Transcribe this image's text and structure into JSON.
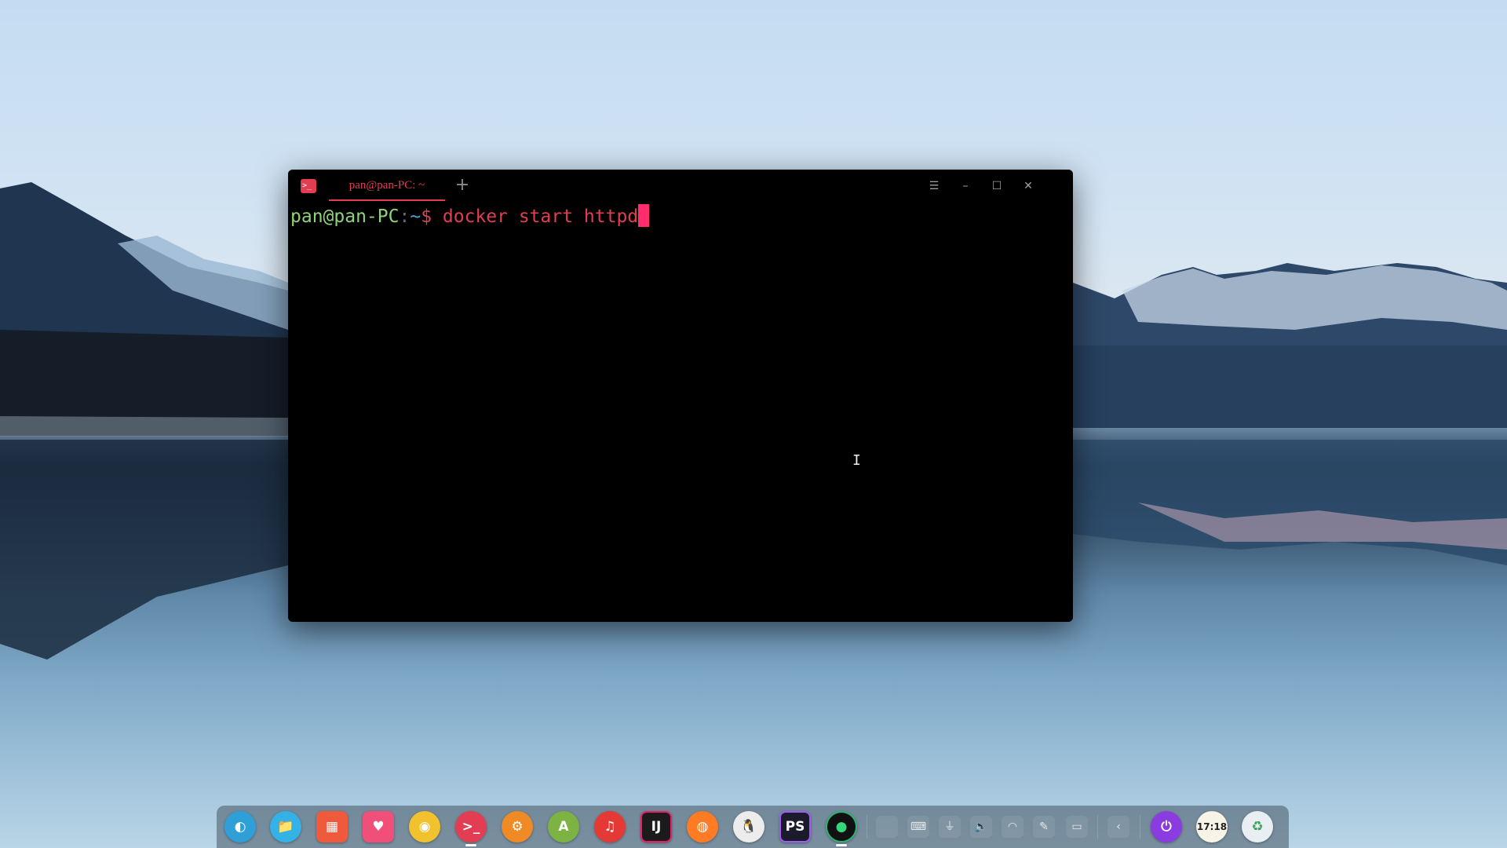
{
  "terminal": {
    "tab_title": "pan@pan-PC: ~",
    "new_tab_label": "+",
    "menu_glyph": "☰",
    "minimize_glyph": "–",
    "maximize_glyph": "☐",
    "close_glyph": "✕",
    "prompt_user": "pan@pan-PC",
    "prompt_colon": ":",
    "prompt_path": "~",
    "prompt_symbol": "$",
    "command": " docker start httpd",
    "accent_color": "#e23d53"
  },
  "dock": {
    "apps": [
      {
        "name": "deepin-launcher-icon",
        "glyph": "◐"
      },
      {
        "name": "file-manager-icon",
        "glyph": "📁"
      },
      {
        "name": "multitasking-view-icon",
        "glyph": "▦"
      },
      {
        "name": "app-store-icon",
        "glyph": "♥"
      },
      {
        "name": "chrome-icon",
        "glyph": "◉"
      },
      {
        "name": "terminal-icon",
        "glyph": ">_"
      },
      {
        "name": "system-settings-icon",
        "glyph": "⚙"
      },
      {
        "name": "android-studio-icon",
        "glyph": "A"
      },
      {
        "name": "music-icon",
        "glyph": "♫"
      },
      {
        "name": "intellij-idea-icon",
        "glyph": "IJ"
      },
      {
        "name": "firefox-icon",
        "glyph": "◍"
      },
      {
        "name": "qq-icon",
        "glyph": "🐧"
      },
      {
        "name": "phpstorm-icon",
        "glyph": "PS"
      },
      {
        "name": "camera-icon",
        "glyph": "●"
      }
    ],
    "tray": [
      {
        "name": "blank-tray-icon",
        "glyph": ""
      },
      {
        "name": "keyboard-icon",
        "glyph": "⌨"
      },
      {
        "name": "usb-icon",
        "glyph": "⏚"
      },
      {
        "name": "volume-icon",
        "glyph": "🔈"
      },
      {
        "name": "wifi-icon",
        "glyph": "◠"
      },
      {
        "name": "pen-icon",
        "glyph": "✎"
      },
      {
        "name": "battery-icon",
        "glyph": "▭"
      },
      {
        "name": "collapse-tray-icon",
        "glyph": "‹"
      }
    ],
    "power_glyph": "⏻",
    "clock_text": "17:18",
    "trash_glyph": "♻"
  }
}
